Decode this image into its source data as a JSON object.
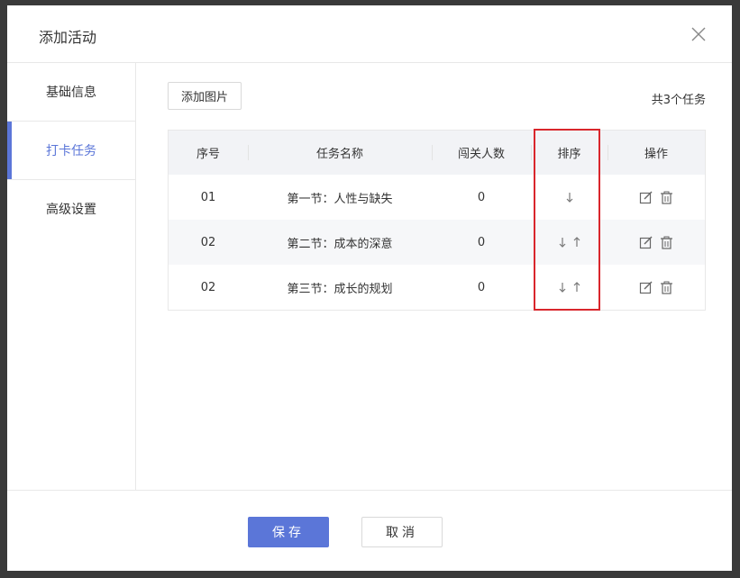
{
  "dialog": {
    "title": "添加活动",
    "close_icon": "close-icon"
  },
  "sidebar": {
    "items": [
      {
        "label": "基础信息"
      },
      {
        "label": "打卡任务"
      },
      {
        "label": "高级设置"
      }
    ],
    "active_index": 1,
    "accent_color": "#5b76d8"
  },
  "main": {
    "add_image_label": "添加图片",
    "task_count": "共3个任务",
    "table": {
      "headers": [
        "序号",
        "任务名称",
        "闯关人数",
        "排序",
        "操作"
      ],
      "rows": [
        {
          "index": "01",
          "name": "第一节：人性与缺失",
          "count": "0",
          "sort": [
            "down"
          ]
        },
        {
          "index": "02",
          "name": "第二节：成本的深意",
          "count": "0",
          "sort": [
            "down",
            "up"
          ]
        },
        {
          "index": "02",
          "name": "第三节：成长的规划",
          "count": "0",
          "sort": [
            "down",
            "up"
          ]
        }
      ]
    }
  },
  "footer": {
    "save_label": "保存",
    "cancel_label": "取消",
    "save_color": "#5b76d8"
  }
}
